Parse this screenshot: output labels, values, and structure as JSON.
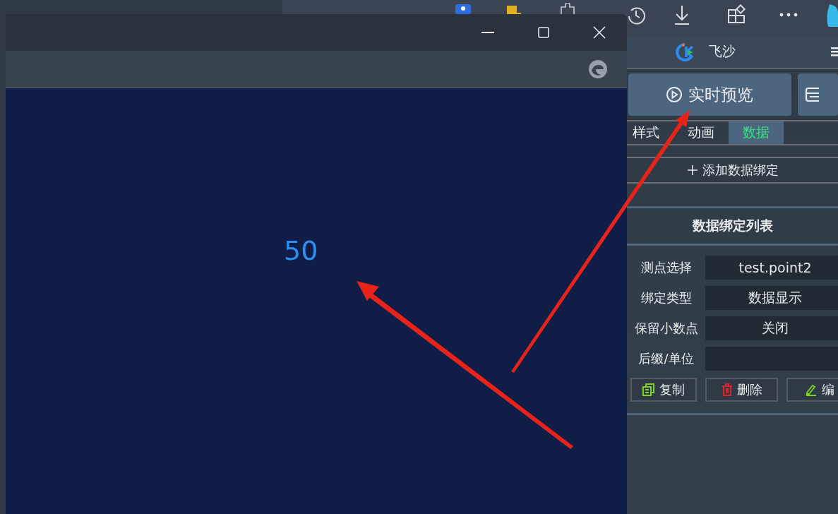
{
  "preview_window": {
    "display_value": "50"
  },
  "panel": {
    "app_name": "飞沙",
    "preview_button": "实时预览",
    "tabs": [
      {
        "label": "样式",
        "selected": false
      },
      {
        "label": "动画",
        "selected": false
      },
      {
        "label": "数据",
        "selected": true
      }
    ],
    "add_binding_button": "添加数据绑定",
    "section_title": "数据绑定列表",
    "fields": [
      {
        "label": "测点选择",
        "value": "test.point2"
      },
      {
        "label": "绑定类型",
        "value": "数据显示"
      },
      {
        "label": "保留小数点",
        "value": "关闭"
      },
      {
        "label": "后缀/单位"
      }
    ],
    "actions": [
      {
        "kind": "copy",
        "label": "复制"
      },
      {
        "kind": "delete",
        "label": "删除"
      },
      {
        "kind": "edit",
        "label": "编"
      }
    ]
  }
}
